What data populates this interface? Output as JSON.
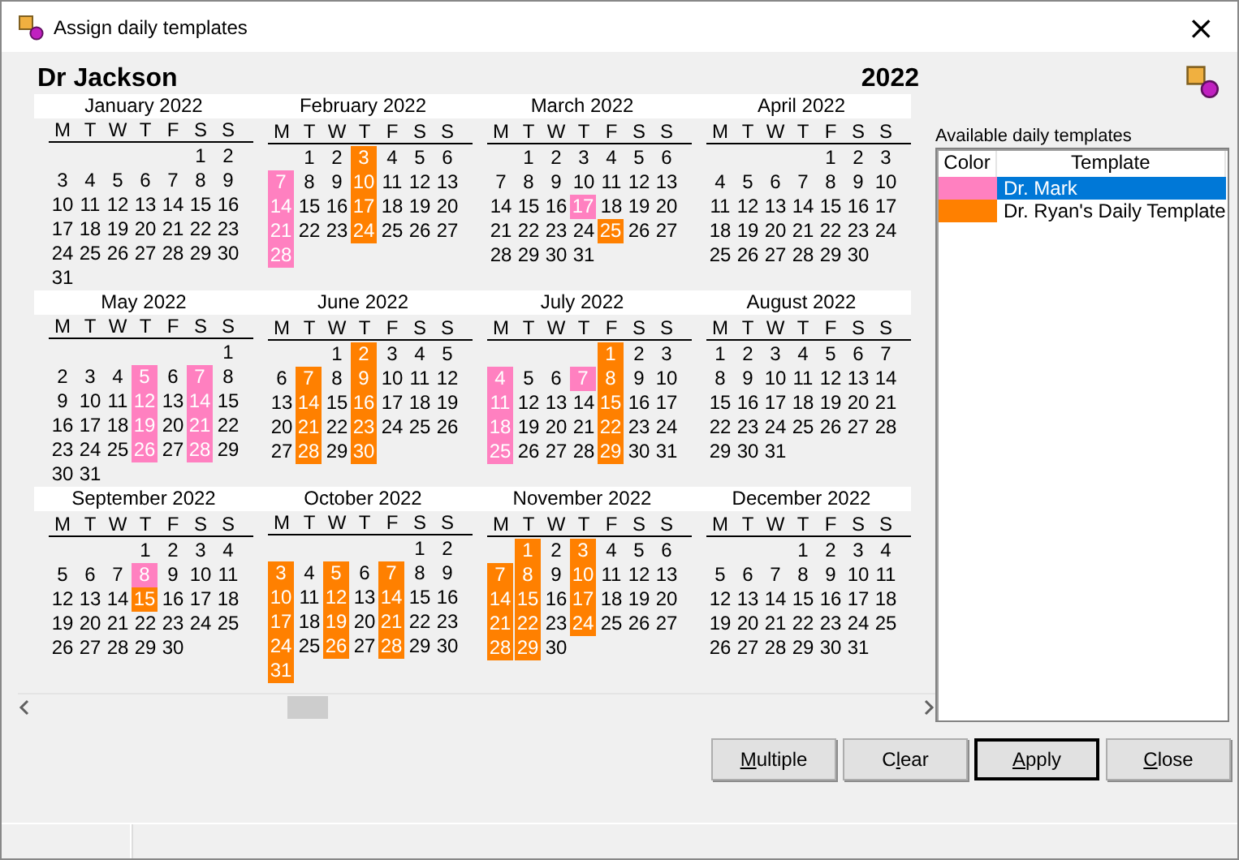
{
  "window": {
    "title": "Assign daily templates",
    "close": "×"
  },
  "calendar": {
    "owner": "Dr Jackson",
    "year": "2022",
    "months": [
      {
        "name": "January 2022",
        "weekdays": [
          "M",
          "T",
          "W",
          "T",
          "F",
          "S",
          "S"
        ],
        "weeks": [
          [
            "1",
            "2"
          ],
          [
            "3",
            "4",
            "5",
            "6",
            "7",
            "8",
            "9"
          ],
          [
            "10",
            "11",
            "12",
            "13",
            "14",
            "15",
            "16"
          ],
          [
            "17",
            "18",
            "19",
            "20",
            "21",
            "22",
            "23"
          ],
          [
            "24",
            "25",
            "26",
            "27",
            "28",
            "29",
            "30"
          ],
          [
            "31"
          ]
        ]
      },
      {
        "name": "February 2022",
        "weekdays": [
          "M",
          "T",
          "W",
          "T",
          "F",
          "S",
          "S"
        ],
        "weeks": [
          [
            "1",
            "2",
            {
              "d": "3",
              "color": "#ff8000"
            },
            "4",
            "5",
            "6"
          ],
          [
            {
              "d": "7",
              "color": "#ff80c0"
            },
            "8",
            "9",
            {
              "d": "10",
              "color": "#ff8000"
            },
            "11",
            "12",
            "13"
          ],
          [
            {
              "d": "14",
              "color": "#ff80c0"
            },
            "15",
            "16",
            {
              "d": "17",
              "color": "#ff8000"
            },
            "18",
            "19",
            "20"
          ],
          [
            {
              "d": "21",
              "color": "#ff80c0"
            },
            "22",
            "23",
            {
              "d": "24",
              "color": "#ff8000"
            },
            "25",
            "26",
            "27"
          ],
          [
            {
              "d": "28",
              "color": "#ff80c0"
            }
          ]
        ]
      },
      {
        "name": "March 2022",
        "weekdays": [
          "M",
          "T",
          "W",
          "T",
          "F",
          "S",
          "S"
        ],
        "weeks": [
          [
            "1",
            "2",
            "3",
            "4",
            "5",
            "6"
          ],
          [
            "7",
            "8",
            "9",
            "10",
            "11",
            "12",
            "13"
          ],
          [
            "14",
            "15",
            "16",
            {
              "d": "17",
              "color": "#ff80c0"
            },
            "18",
            "19",
            "20"
          ],
          [
            "21",
            "22",
            "23",
            "24",
            {
              "d": "25",
              "color": "#ff8000"
            },
            "26",
            "27"
          ],
          [
            "28",
            "29",
            "30",
            "31"
          ]
        ]
      },
      {
        "name": "April 2022",
        "weekdays": [
          "M",
          "T",
          "W",
          "T",
          "F",
          "S",
          "S"
        ],
        "weeks": [
          [
            "1",
            "2",
            "3"
          ],
          [
            "4",
            "5",
            "6",
            "7",
            "8",
            "9",
            "10"
          ],
          [
            "11",
            "12",
            "13",
            "14",
            "15",
            "16",
            "17"
          ],
          [
            "18",
            "19",
            "20",
            "21",
            "22",
            "23",
            "24"
          ],
          [
            "25",
            "26",
            "27",
            "28",
            "29",
            "30"
          ]
        ]
      },
      {
        "name": "May 2022",
        "weekdays": [
          "M",
          "T",
          "W",
          "T",
          "F",
          "S",
          "S"
        ],
        "weeks": [
          [
            "1"
          ],
          [
            "2",
            "3",
            "4",
            {
              "d": "5",
              "color": "#ff80c0"
            },
            "6",
            {
              "d": "7",
              "color": "#ff80c0"
            },
            "8"
          ],
          [
            "9",
            "10",
            "11",
            {
              "d": "12",
              "color": "#ff80c0"
            },
            "13",
            {
              "d": "14",
              "color": "#ff80c0"
            },
            "15"
          ],
          [
            "16",
            "17",
            "18",
            {
              "d": "19",
              "color": "#ff80c0"
            },
            "20",
            {
              "d": "21",
              "color": "#ff80c0"
            },
            "22"
          ],
          [
            "23",
            "24",
            "25",
            {
              "d": "26",
              "color": "#ff80c0"
            },
            "27",
            {
              "d": "28",
              "color": "#ff80c0"
            },
            "29"
          ],
          [
            "30",
            "31"
          ]
        ]
      },
      {
        "name": "June 2022",
        "weekdays": [
          "M",
          "T",
          "W",
          "T",
          "F",
          "S",
          "S"
        ],
        "weeks": [
          [
            "1",
            {
              "d": "2",
              "color": "#ff8000"
            },
            "3",
            "4",
            "5"
          ],
          [
            "6",
            {
              "d": "7",
              "color": "#ff8000"
            },
            "8",
            {
              "d": "9",
              "color": "#ff8000"
            },
            "10",
            "11",
            "12"
          ],
          [
            "13",
            {
              "d": "14",
              "color": "#ff8000"
            },
            "15",
            {
              "d": "16",
              "color": "#ff8000"
            },
            "17",
            "18",
            "19"
          ],
          [
            "20",
            {
              "d": "21",
              "color": "#ff8000"
            },
            "22",
            {
              "d": "23",
              "color": "#ff8000"
            },
            "24",
            "25",
            "26"
          ],
          [
            "27",
            {
              "d": "28",
              "color": "#ff8000"
            },
            "29",
            {
              "d": "30",
              "color": "#ff8000"
            }
          ]
        ]
      },
      {
        "name": "July 2022",
        "weekdays": [
          "M",
          "T",
          "W",
          "T",
          "F",
          "S",
          "S"
        ],
        "weeks": [
          [
            {
              "d": "1",
              "color": "#ff8000"
            },
            "2",
            "3"
          ],
          [
            {
              "d": "4",
              "color": "#ff80c0"
            },
            "5",
            "6",
            {
              "d": "7",
              "color": "#ff80c0"
            },
            {
              "d": "8",
              "color": "#ff8000"
            },
            "9",
            "10"
          ],
          [
            {
              "d": "11",
              "color": "#ff80c0"
            },
            "12",
            "13",
            "14",
            {
              "d": "15",
              "color": "#ff8000"
            },
            "16",
            "17"
          ],
          [
            {
              "d": "18",
              "color": "#ff80c0"
            },
            "19",
            "20",
            "21",
            {
              "d": "22",
              "color": "#ff8000"
            },
            "23",
            "24"
          ],
          [
            {
              "d": "25",
              "color": "#ff80c0"
            },
            "26",
            "27",
            "28",
            {
              "d": "29",
              "color": "#ff8000"
            },
            "30",
            "31"
          ]
        ]
      },
      {
        "name": "August 2022",
        "weekdays": [
          "M",
          "T",
          "W",
          "T",
          "F",
          "S",
          "S"
        ],
        "weeks": [
          [
            "1",
            "2",
            "3",
            "4",
            "5",
            "6",
            "7"
          ],
          [
            "8",
            "9",
            "10",
            "11",
            "12",
            "13",
            "14"
          ],
          [
            "15",
            "16",
            "17",
            "18",
            "19",
            "20",
            "21"
          ],
          [
            "22",
            "23",
            "24",
            "25",
            "26",
            "27",
            "28"
          ],
          [
            "29",
            "30",
            "31"
          ]
        ]
      },
      {
        "name": "September 2022",
        "weekdays": [
          "M",
          "T",
          "W",
          "T",
          "F",
          "S",
          "S"
        ],
        "weeks": [
          [
            "1",
            "2",
            "3",
            "4"
          ],
          [
            "5",
            "6",
            "7",
            {
              "d": "8",
              "color": "#ff80c0"
            },
            "9",
            "10",
            "11"
          ],
          [
            "12",
            "13",
            "14",
            {
              "d": "15",
              "color": "#ff8000"
            },
            "16",
            "17",
            "18"
          ],
          [
            "19",
            "20",
            "21",
            "22",
            "23",
            "24",
            "25"
          ],
          [
            "26",
            "27",
            "28",
            "29",
            "30"
          ]
        ]
      },
      {
        "name": "October 2022",
        "weekdays": [
          "M",
          "T",
          "W",
          "T",
          "F",
          "S",
          "S"
        ],
        "weeks": [
          [
            "1",
            "2"
          ],
          [
            {
              "d": "3",
              "color": "#ff8000"
            },
            "4",
            {
              "d": "5",
              "color": "#ff8000"
            },
            "6",
            {
              "d": "7",
              "color": "#ff8000"
            },
            "8",
            "9"
          ],
          [
            {
              "d": "10",
              "color": "#ff8000"
            },
            "11",
            {
              "d": "12",
              "color": "#ff8000"
            },
            "13",
            {
              "d": "14",
              "color": "#ff8000"
            },
            "15",
            "16"
          ],
          [
            {
              "d": "17",
              "color": "#ff8000"
            },
            "18",
            {
              "d": "19",
              "color": "#ff8000"
            },
            "20",
            {
              "d": "21",
              "color": "#ff8000"
            },
            "22",
            "23"
          ],
          [
            {
              "d": "24",
              "color": "#ff8000"
            },
            "25",
            {
              "d": "26",
              "color": "#ff8000"
            },
            "27",
            {
              "d": "28",
              "color": "#ff8000"
            },
            "29",
            "30"
          ],
          [
            {
              "d": "31",
              "color": "#ff8000"
            }
          ]
        ]
      },
      {
        "name": "November 2022",
        "weekdays": [
          "M",
          "T",
          "W",
          "T",
          "F",
          "S",
          "S"
        ],
        "weeks": [
          [
            {
              "d": "1",
              "color": "#ff8000"
            },
            "2",
            {
              "d": "3",
              "color": "#ff8000"
            },
            "4",
            "5",
            "6"
          ],
          [
            {
              "d": "7",
              "color": "#ff8000"
            },
            {
              "d": "8",
              "color": "#ff8000"
            },
            "9",
            {
              "d": "10",
              "color": "#ff8000"
            },
            "11",
            "12",
            "13"
          ],
          [
            {
              "d": "14",
              "color": "#ff8000"
            },
            {
              "d": "15",
              "color": "#ff8000"
            },
            "16",
            {
              "d": "17",
              "color": "#ff8000"
            },
            "18",
            "19",
            "20"
          ],
          [
            {
              "d": "21",
              "color": "#ff8000"
            },
            {
              "d": "22",
              "color": "#ff8000"
            },
            "23",
            {
              "d": "24",
              "color": "#ff8000"
            },
            "25",
            "26",
            "27"
          ],
          [
            {
              "d": "28",
              "color": "#ff8000"
            },
            {
              "d": "29",
              "color": "#ff8000"
            },
            "30"
          ]
        ]
      },
      {
        "name": "December 2022",
        "weekdays": [
          "M",
          "T",
          "W",
          "T",
          "F",
          "S",
          "S"
        ],
        "weeks": [
          [
            "1",
            "2",
            "3",
            "4"
          ],
          [
            "5",
            "6",
            "7",
            "8",
            "9",
            "10",
            "11"
          ],
          [
            "12",
            "13",
            "14",
            "15",
            "16",
            "17",
            "18"
          ],
          [
            "19",
            "20",
            "21",
            "22",
            "23",
            "24",
            "25"
          ],
          [
            "26",
            "27",
            "28",
            "29",
            "30",
            "31"
          ]
        ]
      }
    ]
  },
  "templates": {
    "label": "Available daily templates",
    "columns": [
      "Color",
      "Template"
    ],
    "rows": [
      {
        "color": "#ff80c0",
        "name": "Dr. Mark",
        "selected": true
      },
      {
        "color": "#ff8000",
        "name": "Dr. Ryan's Daily Template",
        "selected": false
      }
    ]
  },
  "buttons": [
    {
      "parts": [
        {
          "text": "M",
          "underline": true
        },
        {
          "text": "ultiple",
          "underline": false
        }
      ],
      "default": false
    },
    {
      "parts": [
        {
          "text": "C",
          "underline": false
        },
        {
          "text": "l",
          "underline": true
        },
        {
          "text": "ear",
          "underline": false
        }
      ],
      "default": false
    },
    {
      "parts": [
        {
          "text": "A",
          "underline": true
        },
        {
          "text": "pply",
          "underline": false
        }
      ],
      "default": true
    },
    {
      "parts": [
        {
          "text": "C",
          "underline": true
        },
        {
          "text": "lose",
          "underline": false
        }
      ],
      "default": false
    }
  ]
}
